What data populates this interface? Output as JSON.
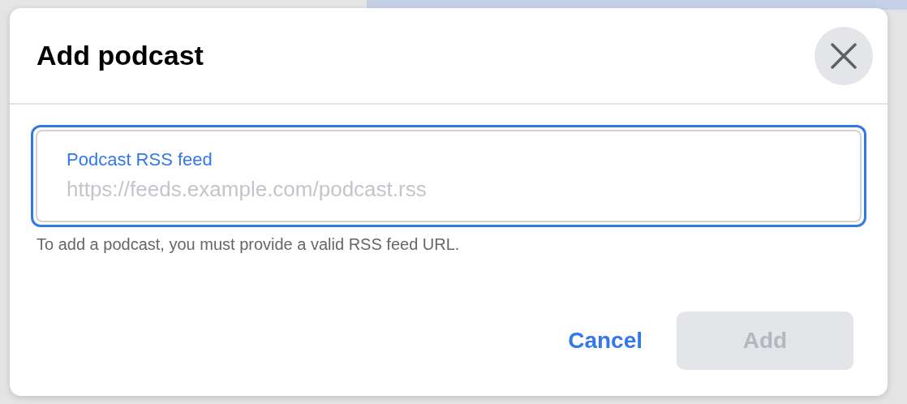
{
  "dialog": {
    "title": "Add podcast",
    "field": {
      "label": "Podcast RSS feed",
      "placeholder": "https://feeds.example.com/podcast.rss",
      "focused": true,
      "help": "To add a podcast, you must provide a valid RSS feed URL."
    },
    "buttons": [
      {
        "label": "Cancel",
        "kind": "text",
        "disabled": false
      },
      {
        "label": "Add",
        "kind": "filled",
        "disabled": true
      }
    ]
  }
}
